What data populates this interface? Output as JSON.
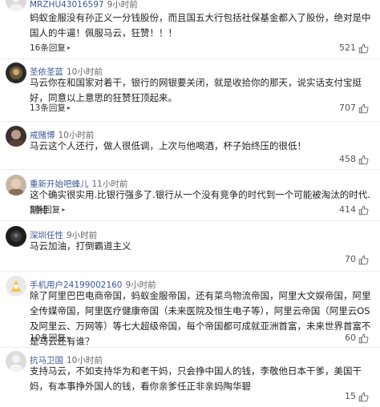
{
  "comments": [
    {
      "user": "MRZHU43016597",
      "time": "9小时前",
      "text": "蚂蚁金服没有孙正义一分钱股份，而且国五大行包括社保基金都入了股份，绝对是中国人的牛逼！佩服马云，狂赞！！！",
      "replies": "16条回复",
      "likes": "521"
    },
    {
      "user": "圣依圣蓝",
      "time": "10小时前",
      "text": "马云你在和国家对着干，银行的网银要关闭，就是收拾你的那天，说实话支付宝挺好，同意以上意思的狂赞狂顶起来。",
      "replies": "13条回复",
      "likes": "707"
    },
    {
      "user": "戒赌博",
      "time": "10小时前",
      "text": "马云这个人还行，做人很低调，上次与他喝酒，杯子始终压的很低！",
      "replies": "",
      "likes": "458"
    },
    {
      "user": "重新开始吧蜂儿",
      "time": "11小时前",
      "text": "这个确实很实用.比银行强多了.银行从一个没有竞争的时代到一个可能被淘汰的时代.期待",
      "replies": "5条回复",
      "likes": "414"
    },
    {
      "user": "深圳任性",
      "time": "9小时前",
      "text": "马云加油，打倒霸道主义",
      "replies": "",
      "likes": "70"
    },
    {
      "user": "手机用户24199002160",
      "time": "9小时前",
      "text": "除了阿里巴巴电商帝国，蚂蚁金服帝国，还有菜鸟物流帝国，阿里大文娱帝国，阿里全传媒帝国，阿里医疗健康帝国（未来医院及恒生电子等），阿里云帝国（阿里云OS及阿里云、万网等）等七大超级帝国，每个帝国都可成就亚洲首富，未来世界首富不是马云还有谁？",
      "replies": "10条回复",
      "likes": "60"
    },
    {
      "user": "抗马卫国",
      "time": "10小时前",
      "text": "支持马云，不如支持华为和老干妈，只会挣中国人的钱，李敬他日本干爹，美国干妈，有本事挣外国人的钱，看你亲爹任正非亲妈陶华碧",
      "replies": "",
      "likes": "15"
    }
  ],
  "icons": {
    "reply_chevron": "chevron-right-icon",
    "like": "thumbs-up-icon"
  },
  "colors": {
    "username": "#3b5998",
    "text": "#222222",
    "meta": "#666666",
    "divider": "#ececec"
  }
}
